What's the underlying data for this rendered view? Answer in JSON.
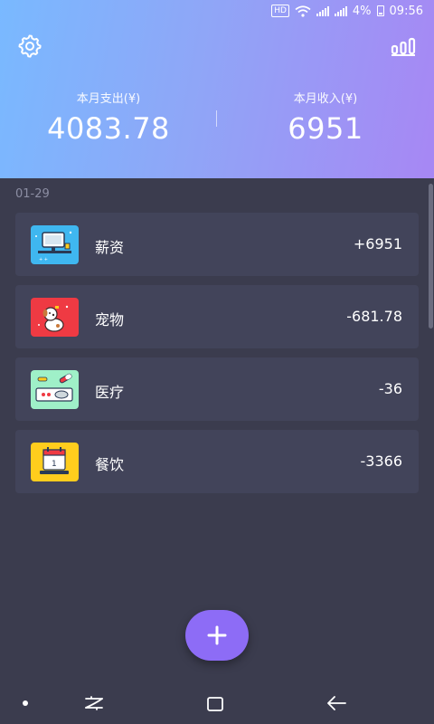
{
  "status_bar": {
    "hd": "HD",
    "battery": "4%",
    "time": "09:56"
  },
  "header": {
    "expense_label": "本月支出(¥)",
    "expense_value": "4083.78",
    "income_label": "本月收入(¥)",
    "income_value": "6951",
    "settings_icon": "gear-icon",
    "stats_icon": "bar-chart-icon"
  },
  "list": {
    "date": "01-29",
    "items": [
      {
        "category": "薪资",
        "amount": "+6951",
        "icon": "salary-monitor-icon",
        "icon_color": "#3fb7f0"
      },
      {
        "category": "宠物",
        "amount": "-681.78",
        "icon": "pet-dog-icon",
        "icon_color": "#ef3a43"
      },
      {
        "category": "医疗",
        "amount": "-36",
        "icon": "medical-pill-icon",
        "icon_color": "#9ff0c8"
      },
      {
        "category": "餐饮",
        "amount": "-3366",
        "icon": "dining-calendar-icon",
        "icon_color": "#ffcd1d"
      }
    ]
  },
  "fab": {
    "icon": "plus-icon",
    "color": "#8d6cf6"
  },
  "colors": {
    "background": "#3b3c4e",
    "card": "#42445a",
    "header_gradient_start": "#79b9ff",
    "header_gradient_end": "#a787f4"
  }
}
